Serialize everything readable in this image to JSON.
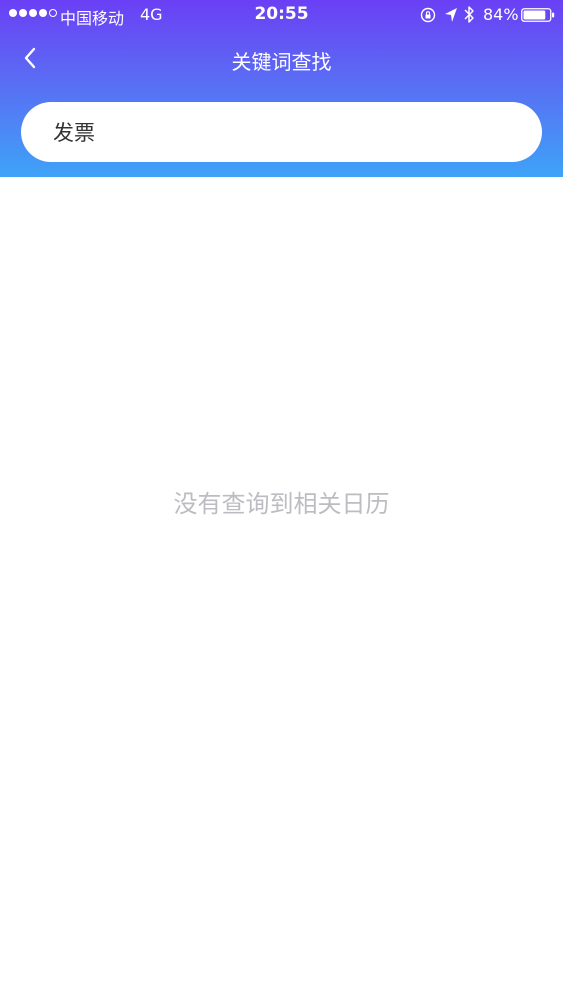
{
  "status_bar": {
    "carrier": "中国移动",
    "network": "4G",
    "time": "20:55",
    "battery_percent": "84%",
    "signal_level": 4,
    "signal_max": 5,
    "battery_level": 0.84,
    "icons": [
      "lock-rotation-icon",
      "location-arrow-icon",
      "bluetooth-icon",
      "battery-icon"
    ]
  },
  "nav": {
    "title": "关键词查找",
    "back_icon": "chevron-left-icon"
  },
  "search": {
    "value": "发票"
  },
  "results": {
    "empty_message": "没有查询到相关日历"
  },
  "colors": {
    "header_top": "#6b3ff5",
    "header_bottom": "#3ea3f7",
    "empty_text": "#bcbcc2"
  }
}
